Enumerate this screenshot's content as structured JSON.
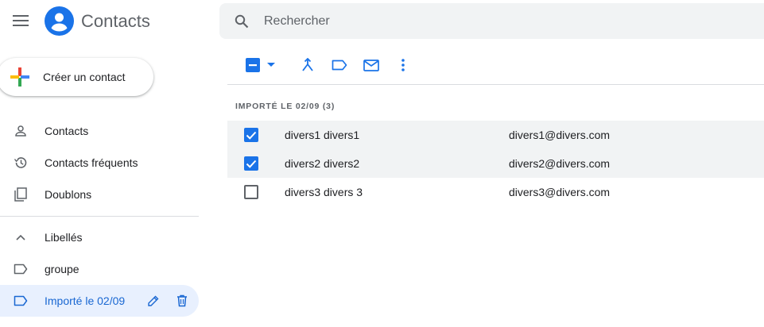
{
  "header": {
    "app_title": "Contacts",
    "search_placeholder": "Rechercher"
  },
  "sidebar": {
    "create_label": "Créer un contact",
    "items": [
      {
        "label": "Contacts",
        "icon": "person-icon"
      },
      {
        "label": "Contacts fréquents",
        "icon": "history-icon"
      },
      {
        "label": "Doublons",
        "icon": "copy-icon"
      }
    ],
    "labels_header": "Libellés",
    "labels": [
      {
        "label": "groupe",
        "icon": "label-icon"
      },
      {
        "label": "Importé le 02/09",
        "icon": "label-icon",
        "active": true
      }
    ]
  },
  "toolbar": {
    "icons": [
      "select-checkbox-icon",
      "dropdown-arrow-icon",
      "merge-icon",
      "label-icon",
      "email-icon",
      "more-vert-icon"
    ]
  },
  "list": {
    "section_title": "IMPORTÉ LE 02/09 (3)",
    "rows": [
      {
        "name": "divers1 divers1",
        "email": "divers1@divers.com",
        "checked": true
      },
      {
        "name": "divers2 divers2",
        "email": "divers2@divers.com",
        "checked": true
      },
      {
        "name": "divers3 divers 3",
        "email": "divers3@divers.com",
        "checked": false
      }
    ]
  },
  "colors": {
    "accent": "#1a73e8",
    "active_bg": "#e8f0fe",
    "selected_row_bg": "#f1f3f4"
  }
}
